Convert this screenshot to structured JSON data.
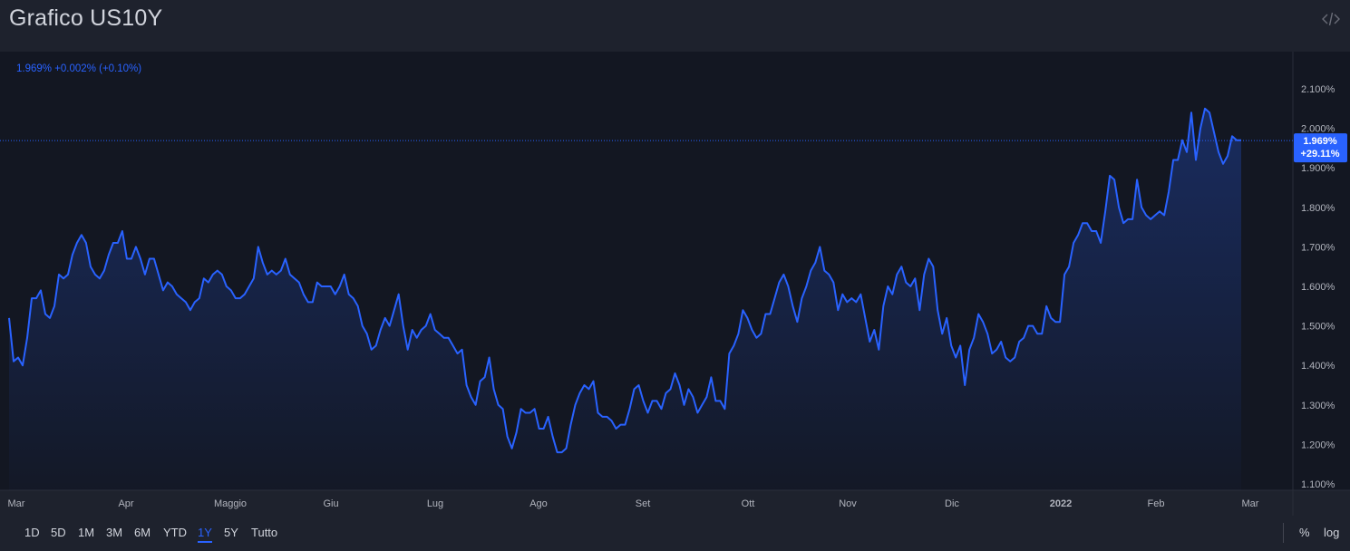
{
  "header": {
    "title": "Grafico US10Y",
    "embed_icon": "code-embed-icon"
  },
  "legend": {
    "text": "1.969% +0.002% (+0.10%)"
  },
  "price_label": {
    "value": "1.969%",
    "change": "+29.11%"
  },
  "toolbar": {
    "ranges": [
      "1D",
      "5D",
      "1M",
      "3M",
      "6M",
      "YTD",
      "1Y",
      "5Y",
      "Tutto"
    ],
    "active": "1Y",
    "percent_label": "%",
    "log_label": "log"
  },
  "colors": {
    "background": "#131722",
    "line": "#2962ff",
    "text": "#b2b5be"
  },
  "chart_data": {
    "type": "area",
    "title": "Grafico US10Y",
    "x_tick_labels": [
      "Mar",
      "Apr",
      "Maggio",
      "Giu",
      "Lug",
      "Ago",
      "Set",
      "Ott",
      "Nov",
      "Dic",
      "2022",
      "Feb",
      "Mar"
    ],
    "y_tick_labels": [
      "2.100%",
      "2.000%",
      "1.900%",
      "1.800%",
      "1.700%",
      "1.600%",
      "1.500%",
      "1.400%",
      "1.300%",
      "1.200%",
      "1.100%"
    ],
    "ylim": [
      1.1,
      2.1
    ],
    "last_value": 1.969,
    "series": [
      {
        "x_start": "2021-02-26",
        "x_end": "2022-02-25",
        "values": [
          1.52,
          1.41,
          1.42,
          1.4,
          1.47,
          1.57,
          1.57,
          1.59,
          1.53,
          1.52,
          1.55,
          1.63,
          1.62,
          1.63,
          1.68,
          1.71,
          1.73,
          1.71,
          1.65,
          1.63,
          1.62,
          1.64,
          1.68,
          1.71,
          1.71,
          1.74,
          1.67,
          1.67,
          1.7,
          1.67,
          1.63,
          1.67,
          1.67,
          1.63,
          1.59,
          1.61,
          1.6,
          1.58,
          1.57,
          1.56,
          1.54,
          1.56,
          1.57,
          1.62,
          1.61,
          1.63,
          1.64,
          1.63,
          1.6,
          1.59,
          1.57,
          1.57,
          1.58,
          1.6,
          1.62,
          1.7,
          1.66,
          1.63,
          1.64,
          1.63,
          1.64,
          1.67,
          1.63,
          1.62,
          1.61,
          1.58,
          1.56,
          1.56,
          1.61,
          1.6,
          1.6,
          1.6,
          1.58,
          1.6,
          1.63,
          1.58,
          1.57,
          1.55,
          1.5,
          1.48,
          1.44,
          1.45,
          1.49,
          1.52,
          1.5,
          1.54,
          1.58,
          1.5,
          1.44,
          1.49,
          1.47,
          1.49,
          1.5,
          1.53,
          1.49,
          1.48,
          1.47,
          1.47,
          1.45,
          1.43,
          1.44,
          1.35,
          1.32,
          1.3,
          1.36,
          1.37,
          1.42,
          1.34,
          1.3,
          1.29,
          1.22,
          1.19,
          1.23,
          1.29,
          1.28,
          1.28,
          1.29,
          1.24,
          1.24,
          1.27,
          1.22,
          1.18,
          1.18,
          1.19,
          1.25,
          1.3,
          1.33,
          1.35,
          1.34,
          1.36,
          1.28,
          1.27,
          1.27,
          1.26,
          1.24,
          1.25,
          1.25,
          1.29,
          1.34,
          1.35,
          1.31,
          1.28,
          1.31,
          1.31,
          1.29,
          1.33,
          1.34,
          1.38,
          1.35,
          1.3,
          1.34,
          1.32,
          1.28,
          1.3,
          1.32,
          1.37,
          1.31,
          1.31,
          1.29,
          1.43,
          1.45,
          1.48,
          1.54,
          1.52,
          1.49,
          1.47,
          1.48,
          1.53,
          1.53,
          1.57,
          1.61,
          1.63,
          1.6,
          1.55,
          1.51,
          1.57,
          1.6,
          1.64,
          1.66,
          1.7,
          1.64,
          1.63,
          1.61,
          1.54,
          1.58,
          1.56,
          1.57,
          1.56,
          1.58,
          1.52,
          1.46,
          1.49,
          1.44,
          1.55,
          1.6,
          1.58,
          1.63,
          1.65,
          1.61,
          1.6,
          1.62,
          1.54,
          1.63,
          1.67,
          1.65,
          1.54,
          1.48,
          1.52,
          1.45,
          1.42,
          1.45,
          1.35,
          1.44,
          1.47,
          1.53,
          1.51,
          1.48,
          1.43,
          1.44,
          1.46,
          1.42,
          1.41,
          1.42,
          1.46,
          1.47,
          1.5,
          1.5,
          1.48,
          1.48,
          1.55,
          1.52,
          1.51,
          1.51,
          1.63,
          1.65,
          1.71,
          1.73,
          1.76,
          1.76,
          1.74,
          1.74,
          1.71,
          1.79,
          1.88,
          1.87,
          1.8,
          1.76,
          1.77,
          1.77,
          1.87,
          1.8,
          1.78,
          1.77,
          1.78,
          1.79,
          1.78,
          1.84,
          1.92,
          1.92,
          1.97,
          1.94,
          2.04,
          1.92,
          2.0,
          2.05,
          2.04,
          1.99,
          1.94,
          1.91,
          1.93,
          1.98,
          1.97,
          1.97
        ]
      }
    ],
    "grid": false,
    "legend_placement": "top-left"
  }
}
